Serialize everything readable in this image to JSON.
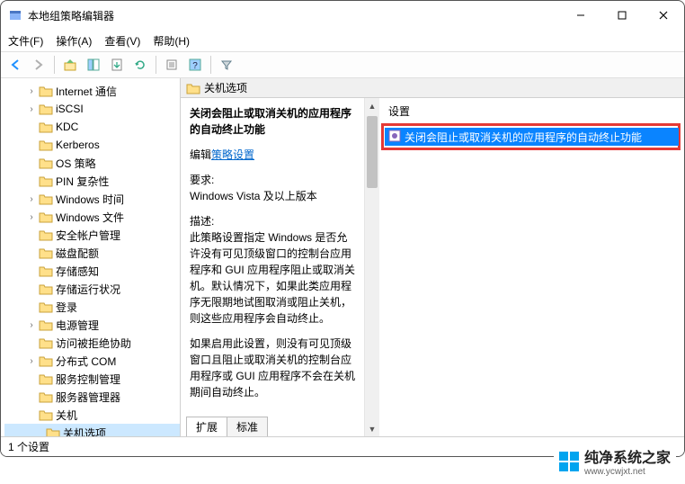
{
  "window": {
    "title": "本地组策略编辑器"
  },
  "menu": {
    "file": "文件(F)",
    "action": "操作(A)",
    "view": "查看(V)",
    "help": "帮助(H)"
  },
  "toolbar_icons": {
    "back": "back-icon",
    "forward": "forward-icon",
    "up": "up-icon",
    "show_hide": "show-hide-icon",
    "export": "export-icon",
    "refresh": "refresh-icon",
    "properties": "properties-icon",
    "help": "help-icon",
    "filter": "filter-icon"
  },
  "tree": {
    "items": [
      {
        "label": "Internet 通信",
        "expandable": true
      },
      {
        "label": "iSCSI",
        "expandable": true
      },
      {
        "label": "KDC",
        "expandable": false
      },
      {
        "label": "Kerberos",
        "expandable": false
      },
      {
        "label": "OS 策略",
        "expandable": false
      },
      {
        "label": "PIN 复杂性",
        "expandable": false
      },
      {
        "label": "Windows 时间",
        "expandable": true
      },
      {
        "label": "Windows 文件",
        "expandable": true
      },
      {
        "label": "安全帐户管理",
        "expandable": false
      },
      {
        "label": "磁盘配额",
        "expandable": false
      },
      {
        "label": "存储感知",
        "expandable": false
      },
      {
        "label": "存储运行状况",
        "expandable": false
      },
      {
        "label": "登录",
        "expandable": false
      },
      {
        "label": "电源管理",
        "expandable": true
      },
      {
        "label": "访问被拒绝协助",
        "expandable": false
      },
      {
        "label": "分布式 COM",
        "expandable": true
      },
      {
        "label": "服务控制管理",
        "expandable": false
      },
      {
        "label": "服务器管理器",
        "expandable": false
      },
      {
        "label": "关机",
        "expandable": false
      },
      {
        "label": "关机选项",
        "expandable": false,
        "selected": true
      }
    ]
  },
  "right_header": {
    "title": "关机选项"
  },
  "details": {
    "title": "关闭会阻止或取消关机的应用程序的自动终止功能",
    "edit_prefix": "编辑",
    "edit_link": "策略设置",
    "req_label": "要求:",
    "req_value": "Windows Vista 及以上版本",
    "desc_label": "描述:",
    "desc_p1": "此策略设置指定 Windows 是否允许没有可见顶级窗口的控制台应用程序和 GUI 应用程序阻止或取消关机。默认情况下，如果此类应用程序无限期地试图取消或阻止关机，则这些应用程序会自动终止。",
    "desc_p2": "如果启用此设置，则没有可见顶级窗口且阻止或取消关机的控制台应用程序或 GUI 应用程序不会在关机期间自动终止。"
  },
  "settings": {
    "header": "设置",
    "item": "关闭会阻止或取消关机的应用程序的自动终止功能"
  },
  "tabs": {
    "extended": "扩展",
    "standard": "标准"
  },
  "statusbar": {
    "text": "1 个设置"
  },
  "watermark": {
    "text": "纯净系统之家",
    "url": "www.ycwjxt.net"
  }
}
